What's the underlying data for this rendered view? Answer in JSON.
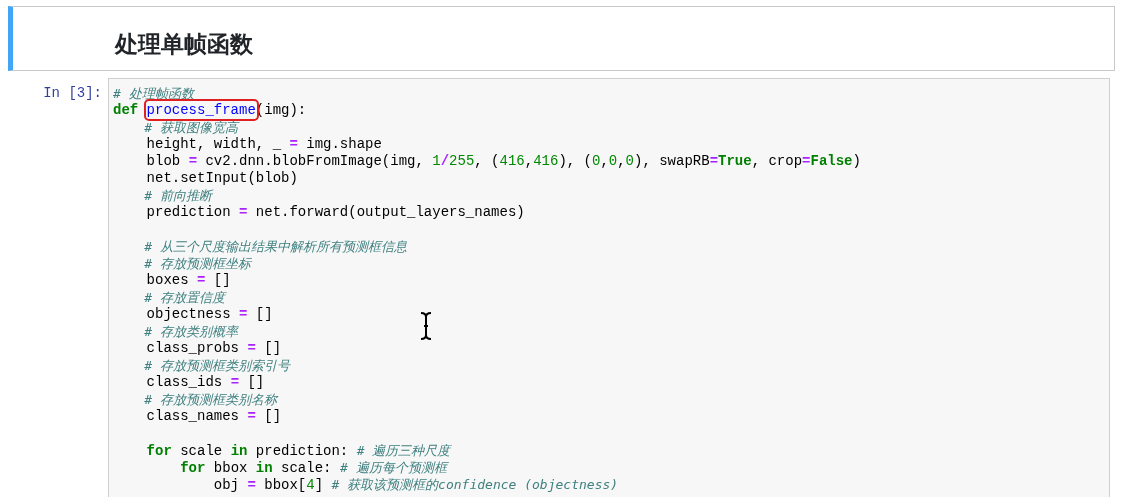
{
  "cells": [
    {
      "kind": "markdown",
      "selected": true,
      "heading": "处理单帧函数"
    },
    {
      "kind": "code",
      "selected": false,
      "prompt": "In [3]:",
      "lines": [
        {
          "kind": "code",
          "tokens": [
            {
              "kind": "comment",
              "text": "# 处理帧函数"
            }
          ]
        },
        {
          "kind": "code",
          "tokens": [
            {
              "kind": "keyword",
              "text": "def "
            },
            {
              "kind": "function",
              "text": "process_frame",
              "boxed": true
            },
            {
              "kind": "text",
              "text": "(img):"
            }
          ]
        },
        {
          "kind": "code",
          "tokens": [
            {
              "kind": "comment",
              "text": "    # 获取图像宽高"
            }
          ]
        },
        {
          "kind": "code",
          "tokens": [
            {
              "kind": "text",
              "text": "    height, width, _ "
            },
            {
              "kind": "operator",
              "text": "="
            },
            {
              "kind": "text",
              "text": " img.shape"
            }
          ]
        },
        {
          "kind": "code",
          "tokens": [
            {
              "kind": "text",
              "text": "    blob "
            },
            {
              "kind": "operator",
              "text": "="
            },
            {
              "kind": "text",
              "text": " cv2.dnn.blobFromImage(img, "
            },
            {
              "kind": "number",
              "text": "1"
            },
            {
              "kind": "operator",
              "text": "/"
            },
            {
              "kind": "number",
              "text": "255"
            },
            {
              "kind": "text",
              "text": ", ("
            },
            {
              "kind": "number",
              "text": "416"
            },
            {
              "kind": "text",
              "text": ","
            },
            {
              "kind": "number",
              "text": "416"
            },
            {
              "kind": "text",
              "text": "), ("
            },
            {
              "kind": "number",
              "text": "0"
            },
            {
              "kind": "text",
              "text": ","
            },
            {
              "kind": "number",
              "text": "0"
            },
            {
              "kind": "text",
              "text": ","
            },
            {
              "kind": "number",
              "text": "0"
            },
            {
              "kind": "text",
              "text": "), swapRB"
            },
            {
              "kind": "operator",
              "text": "="
            },
            {
              "kind": "keyword",
              "text": "True"
            },
            {
              "kind": "text",
              "text": ", crop"
            },
            {
              "kind": "operator",
              "text": "="
            },
            {
              "kind": "keyword",
              "text": "False"
            },
            {
              "kind": "text",
              "text": ")"
            }
          ]
        },
        {
          "kind": "code",
          "tokens": [
            {
              "kind": "text",
              "text": "    net.setInput(blob)"
            }
          ]
        },
        {
          "kind": "code",
          "tokens": [
            {
              "kind": "comment",
              "text": "    # 前向推断"
            }
          ]
        },
        {
          "kind": "code",
          "tokens": [
            {
              "kind": "text",
              "text": "    prediction "
            },
            {
              "kind": "operator",
              "text": "="
            },
            {
              "kind": "text",
              "text": " net.forward(output_layers_names)"
            }
          ]
        },
        {
          "kind": "blank"
        },
        {
          "kind": "code",
          "tokens": [
            {
              "kind": "comment",
              "text": "    # 从三个尺度输出结果中解析所有预测框信息"
            }
          ]
        },
        {
          "kind": "code",
          "tokens": [
            {
              "kind": "comment",
              "text": "    # 存放预测框坐标"
            }
          ]
        },
        {
          "kind": "code",
          "tokens": [
            {
              "kind": "text",
              "text": "    boxes "
            },
            {
              "kind": "operator",
              "text": "="
            },
            {
              "kind": "text",
              "text": " []"
            }
          ]
        },
        {
          "kind": "code",
          "tokens": [
            {
              "kind": "comment",
              "text": "    # 存放置信度"
            }
          ]
        },
        {
          "kind": "code",
          "tokens": [
            {
              "kind": "text",
              "text": "    objectness "
            },
            {
              "kind": "operator",
              "text": "="
            },
            {
              "kind": "text",
              "text": " []"
            }
          ]
        },
        {
          "kind": "code",
          "tokens": [
            {
              "kind": "comment",
              "text": "    # 存放类别概率"
            }
          ]
        },
        {
          "kind": "code",
          "tokens": [
            {
              "kind": "text",
              "text": "    class_probs "
            },
            {
              "kind": "operator",
              "text": "="
            },
            {
              "kind": "text",
              "text": " []"
            }
          ]
        },
        {
          "kind": "code",
          "tokens": [
            {
              "kind": "comment",
              "text": "    # 存放预测框类别索引号"
            }
          ]
        },
        {
          "kind": "code",
          "tokens": [
            {
              "kind": "text",
              "text": "    class_ids "
            },
            {
              "kind": "operator",
              "text": "="
            },
            {
              "kind": "text",
              "text": " []"
            }
          ]
        },
        {
          "kind": "code",
          "tokens": [
            {
              "kind": "comment",
              "text": "    # 存放预测框类别名称"
            }
          ]
        },
        {
          "kind": "code",
          "tokens": [
            {
              "kind": "text",
              "text": "    class_names "
            },
            {
              "kind": "operator",
              "text": "="
            },
            {
              "kind": "text",
              "text": " []"
            }
          ]
        },
        {
          "kind": "blank"
        },
        {
          "kind": "code",
          "tokens": [
            {
              "kind": "keyword",
              "text": "    for"
            },
            {
              "kind": "text",
              "text": " scale "
            },
            {
              "kind": "keyword",
              "text": "in"
            },
            {
              "kind": "text",
              "text": " prediction: "
            },
            {
              "kind": "comment",
              "text": "# 遍历三种尺度"
            }
          ]
        },
        {
          "kind": "code",
          "tokens": [
            {
              "kind": "keyword",
              "text": "        for"
            },
            {
              "kind": "text",
              "text": " bbox "
            },
            {
              "kind": "keyword",
              "text": "in"
            },
            {
              "kind": "text",
              "text": " scale: "
            },
            {
              "kind": "comment",
              "text": "# 遍历每个预测框"
            }
          ]
        },
        {
          "kind": "code",
          "tokens": [
            {
              "kind": "text",
              "text": "            obj "
            },
            {
              "kind": "operator",
              "text": "="
            },
            {
              "kind": "text",
              "text": " bbox["
            },
            {
              "kind": "number",
              "text": "4"
            },
            {
              "kind": "text",
              "text": "] "
            },
            {
              "kind": "comment",
              "text": "# 获取该预测框的confidence (objectness)"
            }
          ]
        }
      ]
    }
  ]
}
